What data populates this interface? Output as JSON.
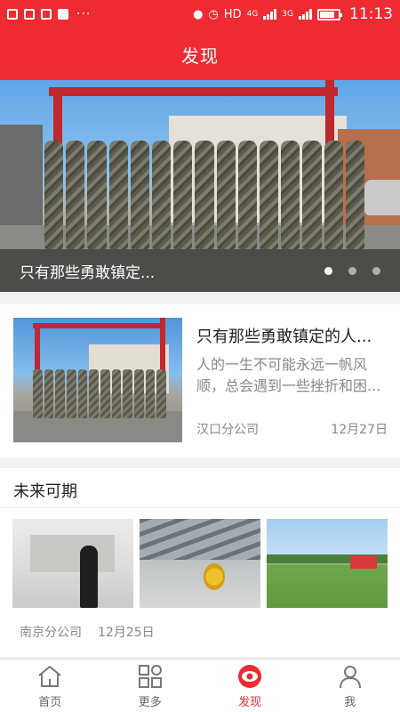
{
  "status_bar": {
    "network": "HD",
    "signal_1": "4G",
    "signal_2": "3G",
    "time": "11:13"
  },
  "header": {
    "title": "发现"
  },
  "banner": {
    "caption": "只有那些勇敢镇定...",
    "active_slide": 1,
    "slide_count": 3
  },
  "article": {
    "title": "只有那些勇敢镇定的人...",
    "summary": "人的一生不可能永远一帆风顺，总会遇到一些挫折和困...",
    "source": "汉口分公司",
    "date": "12月27日"
  },
  "section": {
    "title": "未来可期",
    "source": "南京分公司",
    "date": "12月25日"
  },
  "tabs": [
    {
      "label": "首页",
      "icon": "home-icon",
      "active": false
    },
    {
      "label": "更多",
      "icon": "grid-icon",
      "active": false
    },
    {
      "label": "发现",
      "icon": "eye-icon",
      "active": true
    },
    {
      "label": "我",
      "icon": "person-icon",
      "active": false
    }
  ],
  "colors": {
    "brand": "#ee2b33"
  }
}
